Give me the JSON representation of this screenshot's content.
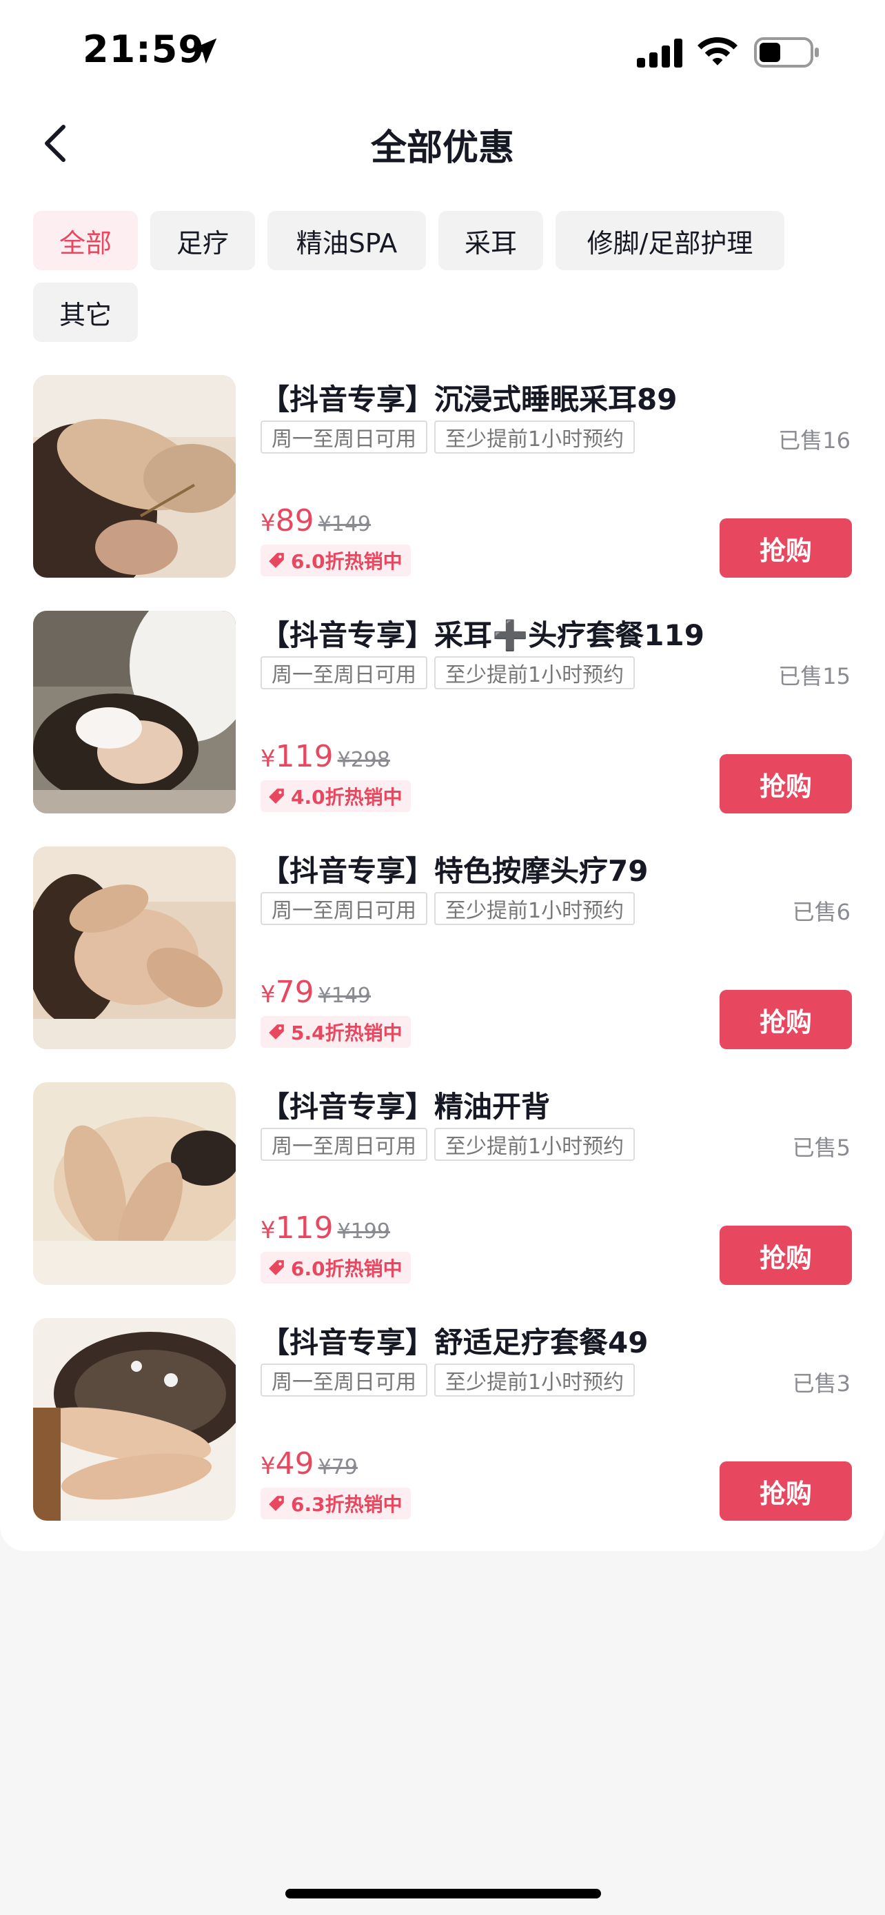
{
  "status_bar": {
    "time": "21:59"
  },
  "nav": {
    "title": "全部优惠"
  },
  "tabs": [
    {
      "label": "全部",
      "active": true
    },
    {
      "label": "足疗",
      "active": false
    },
    {
      "label": "精油SPA",
      "active": false
    },
    {
      "label": "采耳",
      "active": false
    },
    {
      "label": "修脚/足部护理",
      "active": false
    },
    {
      "label": "其它",
      "active": false
    }
  ],
  "colors": {
    "accent": "#e8485f",
    "accent_bg": "#fdeff1",
    "tab_bg": "#f2f2f2"
  },
  "deals": [
    {
      "title": "【抖音专享】沉浸式睡眠采耳89",
      "tags": [
        "周一至周日可用",
        "至少提前1小时预约"
      ],
      "sold": "已售16",
      "currency": "¥",
      "price": "89",
      "original_price": "¥149",
      "discount": "6.0折热销中",
      "button": "抢购"
    },
    {
      "title": "【抖音专享】采耳➕头疗套餐119",
      "tags": [
        "周一至周日可用",
        "至少提前1小时预约"
      ],
      "sold": "已售15",
      "currency": "¥",
      "price": "119",
      "original_price": "¥298",
      "discount": "4.0折热销中",
      "button": "抢购"
    },
    {
      "title": "【抖音专享】特色按摩头疗79",
      "tags": [
        "周一至周日可用",
        "至少提前1小时预约"
      ],
      "sold": "已售6",
      "currency": "¥",
      "price": "79",
      "original_price": "¥149",
      "discount": "5.4折热销中",
      "button": "抢购"
    },
    {
      "title": "【抖音专享】精油开背",
      "tags": [
        "周一至周日可用",
        "至少提前1小时预约"
      ],
      "sold": "已售5",
      "currency": "¥",
      "price": "119",
      "original_price": "¥199",
      "discount": "6.0折热销中",
      "button": "抢购"
    },
    {
      "title": "【抖音专享】舒适足疗套餐49",
      "tags": [
        "周一至周日可用",
        "至少提前1小时预约"
      ],
      "sold": "已售3",
      "currency": "¥",
      "price": "49",
      "original_price": "¥79",
      "discount": "6.3折热销中",
      "button": "抢购"
    }
  ]
}
